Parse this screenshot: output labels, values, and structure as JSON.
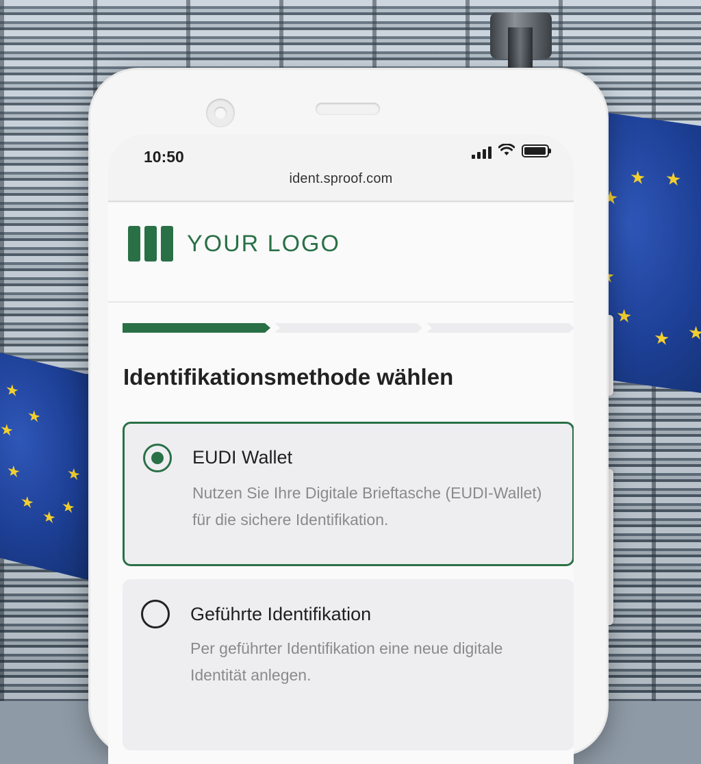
{
  "status_bar": {
    "time": "10:50",
    "icons": [
      "signal-icon",
      "wifi-icon",
      "battery-icon"
    ]
  },
  "browser": {
    "url": "ident.sproof.com"
  },
  "header": {
    "logo_text": "YOUR LOGO",
    "brand_color": "#2a7046"
  },
  "progress": {
    "steps_total": 3,
    "steps_completed": 1
  },
  "main": {
    "heading": "Identifikationsmethode wählen",
    "options": [
      {
        "title": "EUDI Wallet",
        "description": "Nutzen Sie Ihre Digitale Brieftasche (EUDI-Wallet) für die sichere Identifikation.",
        "selected": true
      },
      {
        "title": "Geführte Identifikation",
        "description": "Per geführter Identifikation eine neue digitale Identität anlegen.",
        "selected": false
      }
    ]
  },
  "colors": {
    "accent": "#2a7046",
    "flag_blue": "#1d3f95",
    "flag_star": "#f2cf2e"
  }
}
